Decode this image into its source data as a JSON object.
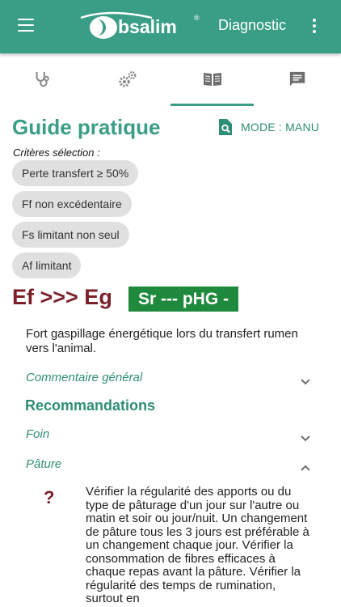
{
  "app": {
    "title": "Diagnostic",
    "logo_text": "bsalim",
    "logo_mark": "®"
  },
  "icons": {
    "menu": "menu-icon",
    "more": "more-vertical-icon",
    "tabs": [
      "stethoscope-icon",
      "gears-icon",
      "book-icon",
      "comment-icon"
    ],
    "search": "search-document-icon",
    "chevron_down": "chevron-down-icon",
    "chevron_up": "chevron-up-icon",
    "help": "question-mark-icon"
  },
  "colors": {
    "primary": "#3a9e86",
    "accent_dark": "#2f8e76",
    "diagnosis": "#7b1f2b",
    "badge": "#1f8a3e",
    "chip": "#e0e0e0"
  },
  "tabs": {
    "active_index": 2
  },
  "guide": {
    "title": "Guide pratique",
    "mode_label": "MODE : MANU",
    "criteria_label": "Critères sélection :",
    "chips": [
      "Perte transfert ≥ 50%",
      "Ff non excédentaire",
      "Fs limitant non seul",
      "Af limitant"
    ]
  },
  "diagnosis": {
    "title": "Ef >>> Eg",
    "badge": "Sr --- pHG -",
    "description": "Fort gaspillage énergétique lors du transfert rumen vers l'animal."
  },
  "sections": {
    "general_comment": "Commentaire général",
    "recommendations": "Recommandations",
    "hay": "Foin",
    "pasture": "Pâture",
    "help_symbol": "?",
    "pasture_text": "Vérifier la régularité des apports ou du type de pâturage d'un jour sur l'autre ou matin et soir ou jour/nuit. Un changement de pâture tous les 3 jours est préférable à un changement chaque jour. Vérifier la consommation de fibres efficaces à chaque repas avant la pâture. Vérifier la régularité des temps de rumination, surtout en"
  }
}
